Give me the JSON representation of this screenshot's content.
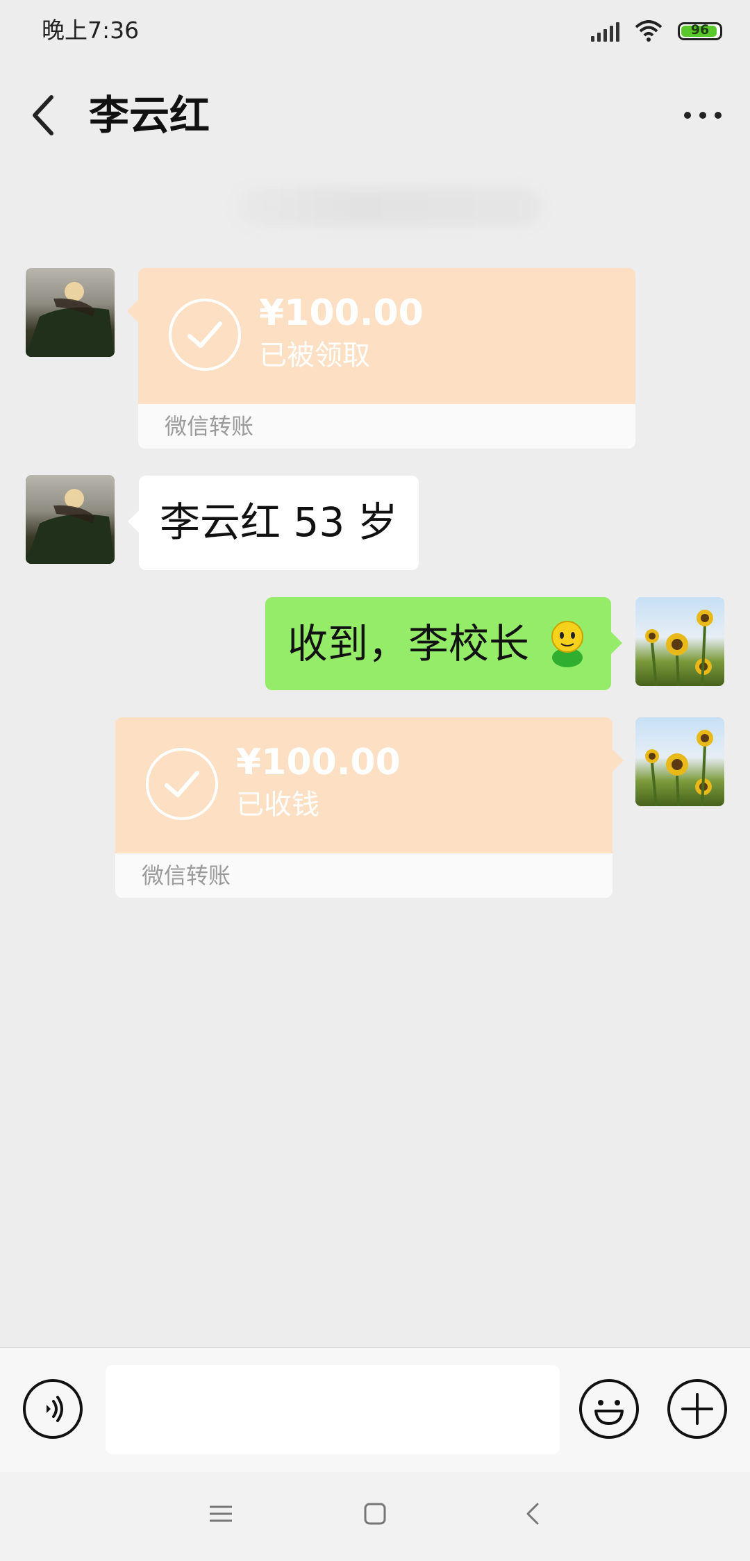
{
  "status_bar": {
    "time": "晚上7:36",
    "battery": "96"
  },
  "header": {
    "title": "李云红"
  },
  "messages": [
    {
      "type": "transfer",
      "from": "them",
      "amount": "¥100.00",
      "status": "已被领取",
      "label": "微信转账"
    },
    {
      "type": "text",
      "from": "them",
      "text": "李云红 53 岁"
    },
    {
      "type": "text",
      "from": "me",
      "text": "收到，李校长"
    },
    {
      "type": "transfer",
      "from": "me",
      "amount": "¥100.00",
      "status": "已收钱",
      "label": "微信转账"
    }
  ],
  "colors": {
    "background": "#ededed",
    "transfer_card": "#fde0c4",
    "my_bubble": "#95ec69",
    "their_bubble": "#ffffff",
    "battery_fill": "#5ac72d"
  },
  "icons": {
    "back": "chevron-left-icon",
    "more": "more-dots-icon",
    "voice": "voice-icon",
    "emoji": "emoji-icon",
    "plus": "plus-icon",
    "nav_menu": "menu-icon",
    "nav_home": "home-icon",
    "nav_back": "back-icon"
  }
}
